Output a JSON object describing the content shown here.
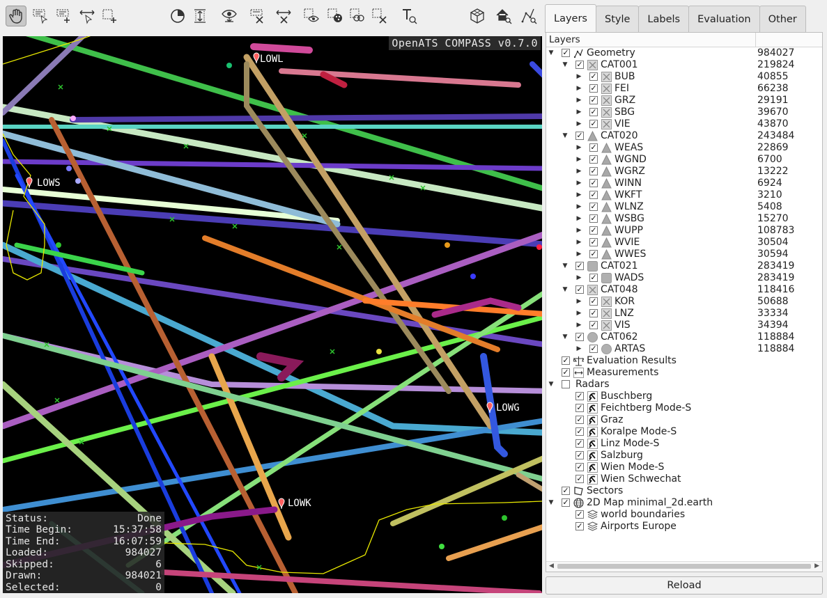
{
  "toolbar": {
    "buttons": [
      {
        "icon": "hand-navigate-icon"
      },
      {
        "icon": "select-label-icon"
      },
      {
        "icon": "add-rectangle-icon"
      },
      {
        "icon": "move-cursor-icon"
      },
      {
        "icon": "select-add-icon"
      },
      {
        "icon": "time-filter-icon"
      },
      {
        "icon": "altitude-filter-icon"
      },
      {
        "icon": "show-selected-icon"
      },
      {
        "icon": "clear-label-icon"
      },
      {
        "icon": "clear-measure-icon"
      },
      {
        "icon": "view-point-icon"
      },
      {
        "icon": "style-point-icon"
      },
      {
        "icon": "copy-point-icon"
      },
      {
        "icon": "clear-points-icon"
      },
      {
        "icon": "text-tool-icon"
      },
      {
        "icon": "grid-3d-icon"
      },
      {
        "icon": "home-search-icon"
      },
      {
        "icon": "zoom-data-icon"
      }
    ]
  },
  "map": {
    "watermark": "OpenATS COMPASS v0.7.0",
    "airports": [
      {
        "name": "LOWL"
      },
      {
        "name": "LOWS"
      },
      {
        "name": "LOWG"
      },
      {
        "name": "LOWK"
      }
    ],
    "status": {
      "rows": [
        {
          "label": "Status:",
          "value": "Done"
        },
        {
          "label": "Time Begin:",
          "value": "15:37:58"
        },
        {
          "label": "Time End:",
          "value": "16:07:59"
        },
        {
          "label": "Loaded:",
          "value": "984027"
        },
        {
          "label": "Skipped:",
          "value": "6"
        },
        {
          "label": "Drawn:",
          "value": "984021"
        },
        {
          "label": "Selected:",
          "value": "0"
        }
      ]
    }
  },
  "tabs": [
    {
      "label": "Layers",
      "active": true
    },
    {
      "label": "Style",
      "active": false
    },
    {
      "label": "Labels",
      "active": false
    },
    {
      "label": "Evaluation",
      "active": false
    },
    {
      "label": "Other",
      "active": false
    }
  ],
  "layers": {
    "header": "Layers",
    "rows": [
      {
        "label": "Geometry",
        "count": "984027",
        "level": 0,
        "arrow": "down",
        "checked": true,
        "icon": "geometry-icon"
      },
      {
        "label": "CAT001",
        "count": "219824",
        "level": 1,
        "arrow": "down",
        "checked": true,
        "icon": "cross-box-icon"
      },
      {
        "label": "BUB",
        "count": "40855",
        "level": 2,
        "arrow": "right",
        "checked": true,
        "icon": "cross-box-icon"
      },
      {
        "label": "FEI",
        "count": "66238",
        "level": 2,
        "arrow": "right",
        "checked": true,
        "icon": "cross-box-icon"
      },
      {
        "label": "GRZ",
        "count": "29191",
        "level": 2,
        "arrow": "right",
        "checked": true,
        "icon": "cross-box-icon"
      },
      {
        "label": "SBG",
        "count": "39670",
        "level": 2,
        "arrow": "right",
        "checked": true,
        "icon": "cross-box-icon"
      },
      {
        "label": "VIE",
        "count": "43870",
        "level": 2,
        "arrow": "right",
        "checked": true,
        "icon": "cross-box-icon"
      },
      {
        "label": "CAT020",
        "count": "243484",
        "level": 1,
        "arrow": "down",
        "checked": true,
        "icon": "triangle-icon"
      },
      {
        "label": "WEAS",
        "count": "22869",
        "level": 2,
        "arrow": "right",
        "checked": true,
        "icon": "triangle-icon"
      },
      {
        "label": "WGND",
        "count": "6700",
        "level": 2,
        "arrow": "right",
        "checked": true,
        "icon": "triangle-icon"
      },
      {
        "label": "WGRZ",
        "count": "13222",
        "level": 2,
        "arrow": "right",
        "checked": true,
        "icon": "triangle-icon"
      },
      {
        "label": "WINN",
        "count": "6924",
        "level": 2,
        "arrow": "right",
        "checked": true,
        "icon": "triangle-icon"
      },
      {
        "label": "WKFT",
        "count": "3210",
        "level": 2,
        "arrow": "right",
        "checked": true,
        "icon": "triangle-icon"
      },
      {
        "label": "WLNZ",
        "count": "5408",
        "level": 2,
        "arrow": "right",
        "checked": true,
        "icon": "triangle-icon"
      },
      {
        "label": "WSBG",
        "count": "15270",
        "level": 2,
        "arrow": "right",
        "checked": true,
        "icon": "triangle-icon"
      },
      {
        "label": "WUPP",
        "count": "108783",
        "level": 2,
        "arrow": "right",
        "checked": true,
        "icon": "triangle-icon"
      },
      {
        "label": "WVIE",
        "count": "30504",
        "level": 2,
        "arrow": "right",
        "checked": true,
        "icon": "triangle-icon"
      },
      {
        "label": "WWES",
        "count": "30594",
        "level": 2,
        "arrow": "right",
        "checked": true,
        "icon": "triangle-icon"
      },
      {
        "label": "CAT021",
        "count": "283419",
        "level": 1,
        "arrow": "down",
        "checked": true,
        "icon": "square-icon"
      },
      {
        "label": "WADS",
        "count": "283419",
        "level": 2,
        "arrow": "right",
        "checked": true,
        "icon": "square-icon"
      },
      {
        "label": "CAT048",
        "count": "118416",
        "level": 1,
        "arrow": "down",
        "checked": true,
        "icon": "cross-box-icon"
      },
      {
        "label": "KOR",
        "count": "50688",
        "level": 2,
        "arrow": "right",
        "checked": true,
        "icon": "cross-box-icon"
      },
      {
        "label": "LNZ",
        "count": "33334",
        "level": 2,
        "arrow": "right",
        "checked": true,
        "icon": "cross-box-icon"
      },
      {
        "label": "VIS",
        "count": "34394",
        "level": 2,
        "arrow": "right",
        "checked": true,
        "icon": "cross-box-icon"
      },
      {
        "label": "CAT062",
        "count": "118884",
        "level": 1,
        "arrow": "down",
        "checked": true,
        "icon": "circle-icon"
      },
      {
        "label": "ARTAS",
        "count": "118884",
        "level": 2,
        "arrow": "right",
        "checked": true,
        "icon": "circle-icon"
      },
      {
        "label": "Evaluation Results",
        "count": "",
        "level": 0,
        "arrow": "",
        "checked": true,
        "icon": "scale-icon"
      },
      {
        "label": "Measurements",
        "count": "",
        "level": 0,
        "arrow": "",
        "checked": true,
        "icon": "measure-icon"
      },
      {
        "label": "Radars",
        "count": "",
        "level": 0,
        "arrow": "down",
        "checked": false,
        "icon": ""
      },
      {
        "label": "Buschberg",
        "count": "",
        "level": 1,
        "arrow": "",
        "checked": true,
        "icon": "radar-icon"
      },
      {
        "label": "Feichtberg Mode-S",
        "count": "",
        "level": 1,
        "arrow": "",
        "checked": true,
        "icon": "radar-icon"
      },
      {
        "label": "Graz",
        "count": "",
        "level": 1,
        "arrow": "",
        "checked": true,
        "icon": "radar-icon"
      },
      {
        "label": "Koralpe Mode-S",
        "count": "",
        "level": 1,
        "arrow": "",
        "checked": true,
        "icon": "radar-icon"
      },
      {
        "label": "Linz Mode-S",
        "count": "",
        "level": 1,
        "arrow": "",
        "checked": true,
        "icon": "radar-icon"
      },
      {
        "label": "Salzburg",
        "count": "",
        "level": 1,
        "arrow": "",
        "checked": true,
        "icon": "radar-icon"
      },
      {
        "label": "Wien Mode-S",
        "count": "",
        "level": 1,
        "arrow": "",
        "checked": true,
        "icon": "radar-icon"
      },
      {
        "label": "Wien Schwechat",
        "count": "",
        "level": 1,
        "arrow": "",
        "checked": true,
        "icon": "radar-icon"
      },
      {
        "label": "Sectors",
        "count": "",
        "level": 0,
        "arrow": "",
        "checked": true,
        "icon": "polygon-icon"
      },
      {
        "label": "2D Map minimal_2d.earth",
        "count": "",
        "level": 0,
        "arrow": "down",
        "checked": true,
        "icon": "globe-icon"
      },
      {
        "label": "world boundaries",
        "count": "",
        "level": 1,
        "arrow": "",
        "checked": true,
        "icon": "layers-icon"
      },
      {
        "label": "Airports Europe",
        "count": "",
        "level": 1,
        "arrow": "",
        "checked": true,
        "icon": "layers-icon"
      }
    ]
  },
  "reload_label": "Reload",
  "colors": {
    "map_background": "#000000",
    "boundary": "#e8e800",
    "pin": "#ff5050"
  }
}
